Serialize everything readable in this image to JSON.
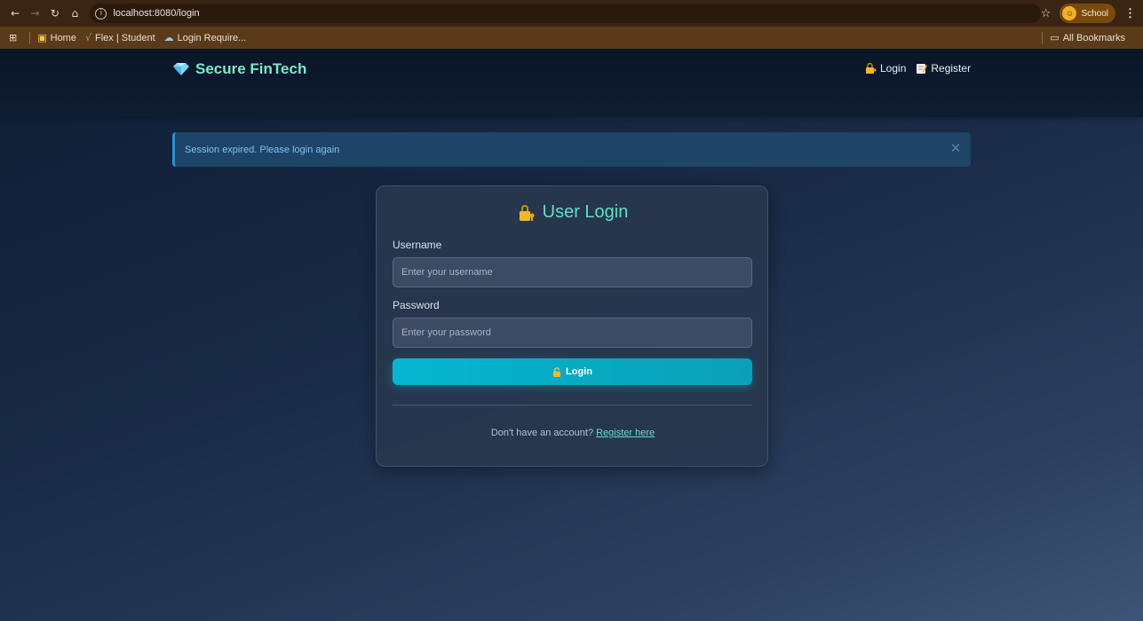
{
  "browser": {
    "url": "localhost:8080/login",
    "profile_label": "School",
    "bookmarks": [
      {
        "label": "Home",
        "icon": "home-picture-icon"
      },
      {
        "label": "Flex | Student",
        "icon": "flex-icon"
      },
      {
        "label": "Login Require...",
        "icon": "cloud-icon"
      }
    ],
    "all_bookmarks_label": "All Bookmarks"
  },
  "header": {
    "brand": "Secure FinTech",
    "nav": [
      {
        "label": "Login",
        "icon": "lock-key-icon"
      },
      {
        "label": "Register",
        "icon": "memo-icon"
      }
    ]
  },
  "alert": {
    "message": "Session expired. Please login again"
  },
  "login_card": {
    "title": "User Login",
    "username_label": "Username",
    "username_placeholder": "Enter your username",
    "password_label": "Password",
    "password_placeholder": "Enter your password",
    "submit_label": "Login",
    "footer_text": "Don't have an account?",
    "register_link": "Register here"
  },
  "colors": {
    "accent": "#62dfc5",
    "button": "#06b6d0",
    "alert_bg": "#1e4468",
    "alert_text": "#7fc2ee"
  }
}
